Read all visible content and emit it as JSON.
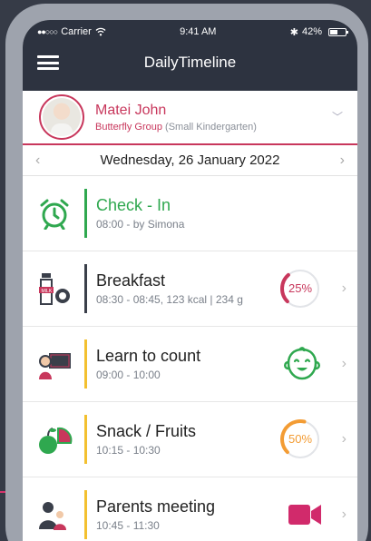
{
  "status_bar": {
    "carrier": "Carrier",
    "time": "9:41 AM",
    "battery": "42%"
  },
  "app": {
    "title": "DailyTimeline"
  },
  "child": {
    "name": "Matei John",
    "group": "Butterfly Group",
    "group_detail": "(Small Kindergarten)"
  },
  "date": {
    "label": "Wednesday, 26 January 2022"
  },
  "colors": {
    "header": "#2d3340",
    "accent": "#c8375c",
    "green": "#2fa84f",
    "orange": "#f39c34",
    "dark": "#3a3f4a",
    "yellow": "#f3c02f"
  },
  "events": [
    {
      "title": "Check - In",
      "subtitle": "08:00 - by Simona",
      "icon": "alarm-clock-icon",
      "bar_color": "#2fa84f",
      "title_color": "#2fa84f"
    },
    {
      "title": "Breakfast",
      "subtitle": "08:30 - 08:45, 123 kcal | 234 g",
      "icon": "milk-bottle-icon",
      "bar_color": "#3a3f4a",
      "progress_label": "25%",
      "progress_fraction": 0.25,
      "progress_color": "#c8375c"
    },
    {
      "title": "Learn to count",
      "subtitle": "09:00 - 10:00",
      "icon": "teacher-board-icon",
      "bar_color": "#f3c02f",
      "indicator": "happy-face-icon"
    },
    {
      "title": "Snack / Fruits",
      "subtitle": "10:15 - 10:30",
      "icon": "fruits-icon",
      "bar_color": "#f3c02f",
      "progress_label": "50%",
      "progress_fraction": 0.5,
      "progress_color": "#f39c34"
    },
    {
      "title": "Parents meeting",
      "subtitle": "10:45 - 11:30",
      "icon": "parents-icon",
      "bar_color": "#f3c02f",
      "indicator": "video-camera-icon"
    }
  ]
}
